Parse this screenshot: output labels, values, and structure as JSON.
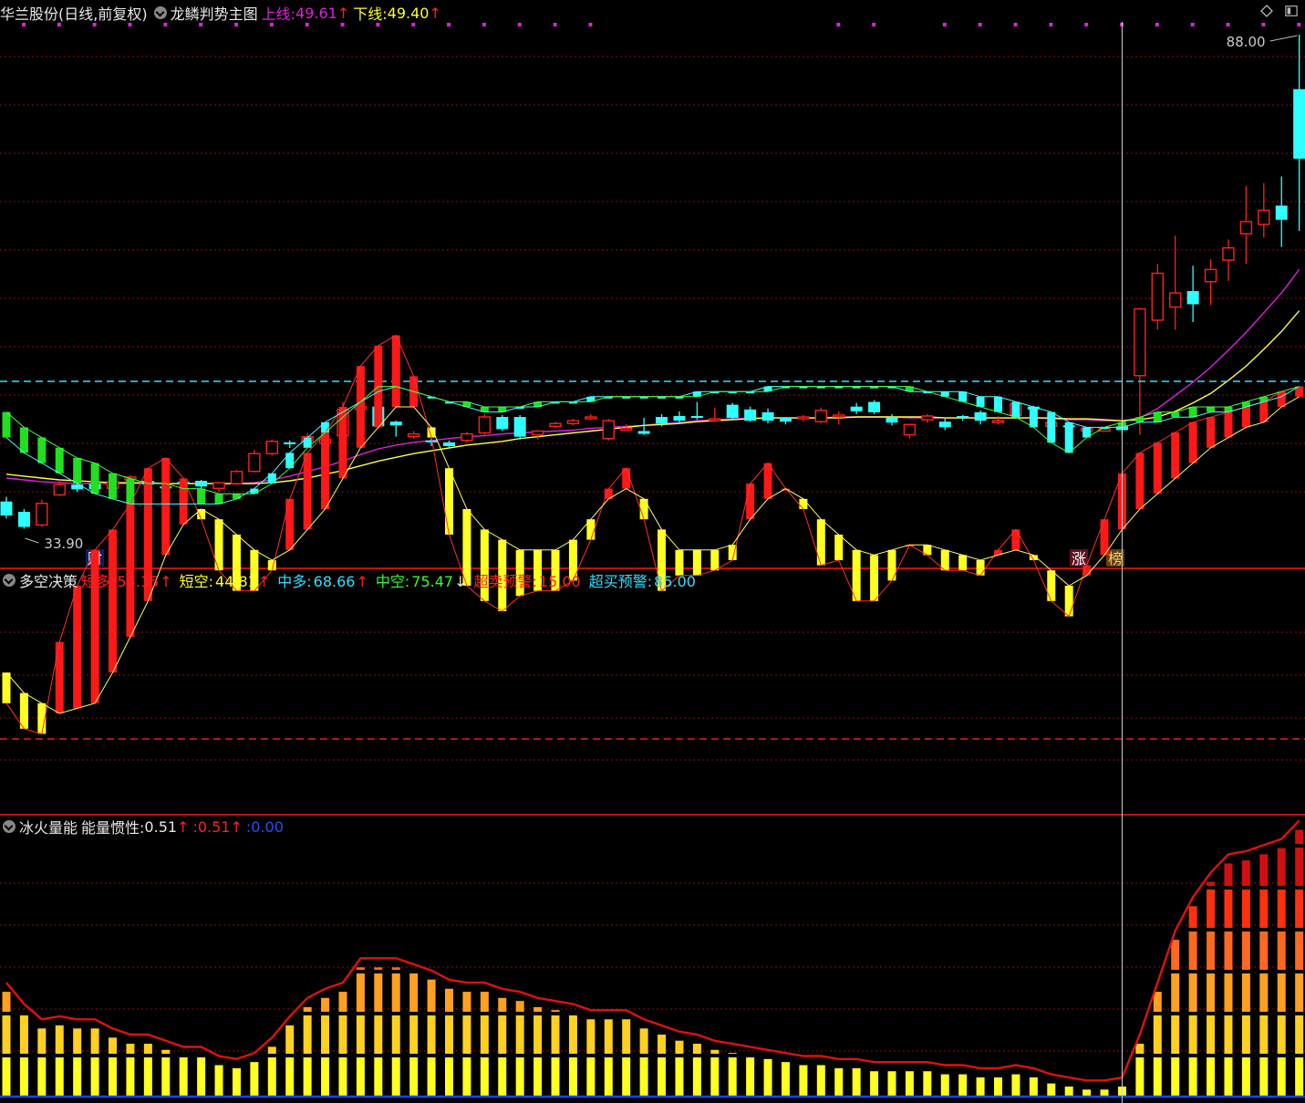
{
  "main_panel": {
    "stock_name": "华兰股份",
    "period": "(日线,前复权)",
    "indicator": "龙鳞判势主图",
    "upper_label": "上线:",
    "upper_value": "49.61",
    "upper_arrow": "↑",
    "lower_label": "下线:",
    "lower_value": "49.40",
    "lower_arrow": "↑",
    "high_marker": "88.00",
    "low_marker": "33.90",
    "badge_cai": "财",
    "badge_zhang": "涨",
    "badge_bang": "榜"
  },
  "panel2": {
    "name": "多空决策",
    "items": [
      {
        "label": "短多:",
        "value": "54.15",
        "arrow": "↑",
        "color": "#ff2020"
      },
      {
        "label": "短空:",
        "value": "44.81",
        "arrow": "↑",
        "color": "#ffff30"
      },
      {
        "label": "中多:",
        "value": "68.66",
        "arrow": "↑",
        "color": "#30e0ff"
      },
      {
        "label": "中空:",
        "value": "75.47",
        "arrow": "↓",
        "color": "#30ff30"
      },
      {
        "label": "超卖预警:",
        "value": "15.00",
        "arrow": "",
        "color": "#ff2020"
      },
      {
        "label": "超买预警:",
        "value": "85.00",
        "arrow": "",
        "color": "#30e0ff"
      }
    ]
  },
  "panel3": {
    "name": "冰火量能",
    "label1": "能量惯性:",
    "value1": "0.51",
    "arrow1": "↑",
    "label2": ":",
    "value2": "0.51",
    "arrow2": "↑",
    "label3": ":",
    "value3": "0.00"
  },
  "colors": {
    "up": "#ff2020",
    "down": "#30ffff",
    "ma1": "#e020e0",
    "ma2": "#ffff40",
    "grid": "#8a1010",
    "separator": "#c01010"
  },
  "chart_data": [
    {
      "type": "candlestick",
      "title": "龙鳞判势主图",
      "ylim": [
        33.9,
        88.0
      ],
      "open": [
        38.3,
        37.2,
        35.8,
        39.0,
        40.1,
        40.2,
        39.7,
        40.6,
        40.5,
        39.9,
        40.4,
        40.5,
        39.7,
        40.2,
        41.5,
        43.4,
        44.6,
        44.7,
        44.5,
        45.3,
        48.1,
        48.4,
        46.8,
        45.2,
        44.8,
        44.6,
        44.8,
        45.6,
        47.3,
        47.3,
        45.4,
        46.3,
        46.6,
        47.2,
        45.0,
        46.0,
        45.8,
        47.3,
        47.4,
        47.4,
        47.1,
        48.6,
        48.1,
        47.8,
        47.2,
        47.2,
        46.8,
        47.4,
        48.4,
        48.9,
        47.3,
        45.4,
        47.0,
        46.8,
        47.4,
        47.8,
        46.9,
        47.5,
        48.4,
        46.3,
        46.4,
        45.8,
        45.8,
        46.3,
        51.7,
        57.6,
        59.0,
        60.7,
        61.7,
        64.0,
        66.8,
        67.8,
        69.8,
        82.2
      ],
      "close": [
        36.8,
        35.6,
        38.1,
        40.1,
        39.6,
        39.6,
        40.4,
        40.9,
        40.1,
        39.7,
        40.2,
        39.9,
        40.3,
        41.5,
        43.4,
        44.7,
        44.4,
        45.2,
        44.9,
        48.1,
        48.4,
        46.3,
        46.4,
        45.5,
        44.6,
        44.2,
        45.5,
        47.3,
        46.0,
        45.2,
        45.8,
        46.6,
        46.9,
        47.3,
        46.9,
        46.1,
        45.5,
        46.6,
        46.9,
        47.3,
        47.1,
        47.2,
        46.9,
        46.9,
        46.8,
        47.3,
        48.0,
        47.5,
        47.9,
        47.8,
        46.7,
        46.5,
        47.4,
        46.2,
        47.2,
        46.9,
        46.9,
        48.7,
        48.1,
        46.7,
        46.3,
        46.1,
        46.1,
        45.9,
        58.8,
        62.6,
        60.5,
        59.3,
        63.0,
        65.3,
        68.1,
        69.3,
        68.3,
        74.8
      ],
      "high": [
        38.8,
        37.5,
        38.5,
        40.6,
        40.4,
        40.4,
        40.7,
        41.1,
        41.0,
        40.3,
        40.5,
        40.6,
        40.4,
        41.7,
        43.8,
        44.9,
        44.8,
        45.6,
        45.6,
        48.9,
        48.7,
        48.4,
        46.9,
        45.8,
        45.0,
        44.8,
        45.7,
        47.6,
        47.5,
        47.5,
        45.9,
        46.8,
        47.1,
        47.6,
        47.1,
        46.5,
        47.2,
        47.6,
        47.9,
        48.9,
        48.3,
        48.8,
        48.4,
        48.2,
        47.3,
        47.5,
        48.3,
        47.9,
        48.8,
        49.1,
        47.6,
        46.5,
        47.6,
        47.2,
        47.5,
        48.0,
        47.4,
        48.9,
        48.5,
        46.8,
        46.5,
        46.2,
        46.2,
        46.4,
        58.9,
        63.6,
        66.6,
        63.4,
        64.1,
        66.2,
        71.9,
        72.2,
        72.9,
        88.0
      ],
      "low": [
        36.5,
        35.4,
        35.6,
        38.9,
        39.3,
        39.5,
        39.6,
        40.4,
        40.0,
        39.4,
        39.9,
        39.5,
        39.3,
        40.1,
        41.4,
        43.2,
        44.0,
        44.5,
        44.0,
        45.1,
        47.7,
        46.1,
        45.2,
        45.0,
        44.2,
        44.0,
        44.6,
        45.4,
        45.8,
        44.9,
        44.9,
        46.1,
        46.4,
        47.0,
        44.8,
        45.8,
        45.4,
        46.3,
        46.6,
        47.0,
        46.9,
        47.0,
        46.8,
        46.6,
        46.5,
        46.8,
        46.6,
        46.5,
        47.6,
        47.6,
        46.4,
        45.0,
        46.7,
        45.9,
        46.9,
        46.5,
        46.5,
        47.3,
        48.0,
        46.2,
        45.9,
        45.9,
        45.7,
        45.4,
        45.4,
        56.6,
        56.6,
        57.4,
        59.2,
        61.8,
        63.6,
        66.4,
        65.4,
        67.1
      ],
      "series": [
        {
          "name": "上线",
          "values": [
            40.8,
            40.6,
            40.4,
            40.3,
            40.2,
            40.2,
            40.2,
            40.2,
            40.2,
            40.2,
            40.2,
            40.2,
            40.2,
            40.2,
            40.3,
            40.6,
            41.0,
            41.5,
            42.0,
            42.6,
            43.3,
            43.9,
            44.3,
            44.6,
            44.8,
            45.0,
            45.2,
            45.3,
            45.5,
            45.6,
            45.7,
            45.8,
            45.9,
            46.1,
            46.2,
            46.3,
            46.4,
            46.6,
            46.7,
            46.9,
            47.0,
            47.1,
            47.2,
            47.2,
            47.2,
            47.2,
            47.2,
            47.3,
            47.3,
            47.3,
            47.3,
            47.2,
            47.2,
            47.2,
            47.2,
            47.2,
            47.2,
            47.2,
            47.2,
            47.1,
            47.0,
            47.0,
            46.9,
            46.9,
            47.2,
            48.2,
            49.6,
            51.0,
            52.6,
            54.4,
            56.3,
            58.4,
            60.5,
            63.0
          ]
        },
        {
          "name": "下线",
          "values": [
            41.2,
            41.0,
            40.8,
            40.6,
            40.5,
            40.4,
            40.3,
            40.3,
            40.3,
            40.2,
            40.2,
            40.2,
            40.2,
            40.2,
            40.2,
            40.3,
            40.5,
            40.8,
            41.2,
            41.6,
            42.1,
            42.6,
            43.0,
            43.4,
            43.7,
            44.0,
            44.3,
            44.5,
            44.7,
            45.0,
            45.2,
            45.4,
            45.6,
            45.8,
            46.0,
            46.2,
            46.4,
            46.5,
            46.6,
            46.8,
            46.9,
            47.0,
            47.1,
            47.2,
            47.2,
            47.2,
            47.2,
            47.2,
            47.3,
            47.3,
            47.3,
            47.3,
            47.3,
            47.2,
            47.2,
            47.2,
            47.2,
            47.2,
            47.2,
            47.2,
            47.1,
            47.1,
            47.0,
            46.9,
            47.0,
            47.3,
            47.9,
            48.8,
            49.8,
            51.2,
            52.7,
            54.5,
            56.4,
            58.6
          ]
        }
      ]
    },
    {
      "type": "bar",
      "title": "多空决策",
      "ylim": [
        0,
        100
      ],
      "overbought": 85.0,
      "oversold": 15.0,
      "series": [
        {
          "name": "短多",
          "values": [
            22,
            17,
            16,
            34,
            45,
            52,
            56,
            61,
            68,
            70,
            66,
            58,
            48,
            44,
            44,
            48,
            62,
            71,
            75,
            80,
            88,
            92,
            94,
            86,
            74,
            55,
            45,
            42,
            40,
            43,
            44,
            44,
            46,
            54,
            64,
            68,
            58,
            44,
            47,
            47,
            48,
            50,
            65,
            69,
            64,
            60,
            49,
            50,
            42,
            42,
            46,
            53,
            51,
            48,
            48,
            47,
            52,
            56,
            50,
            42,
            39,
            49,
            58,
            67,
            71,
            73,
            75,
            77,
            78,
            79,
            80,
            81,
            83,
            84
          ]
        },
        {
          "name": "短空",
          "values": [
            28,
            24,
            22,
            20,
            21,
            22,
            28,
            35,
            42,
            51,
            57,
            60,
            58,
            55,
            52,
            50,
            52,
            56,
            60,
            66,
            72,
            76,
            80,
            80,
            76,
            68,
            60,
            56,
            54,
            52,
            52,
            52,
            54,
            58,
            62,
            64,
            62,
            56,
            52,
            52,
            52,
            53,
            58,
            62,
            64,
            62,
            58,
            55,
            52,
            51,
            52,
            53,
            53,
            52,
            51,
            50,
            51,
            52,
            51,
            48,
            45,
            47,
            51,
            56,
            60,
            63,
            66,
            69,
            72,
            74,
            76,
            77,
            80,
            82
          ]
        },
        {
          "name": "中多",
          "values": [
            74,
            71,
            69,
            67,
            65,
            63,
            62,
            61,
            61,
            61,
            61,
            61,
            61,
            62,
            64,
            67,
            71,
            74,
            77,
            79,
            81,
            83,
            84,
            83,
            82,
            81,
            80,
            79,
            79,
            80,
            80,
            81,
            81,
            82,
            82,
            82,
            82,
            82,
            82,
            83,
            83,
            83,
            83,
            84,
            84,
            84,
            84,
            84,
            84,
            84,
            84,
            83,
            83,
            83,
            83,
            82,
            82,
            81,
            80,
            79,
            77,
            76,
            76,
            76,
            77,
            77,
            78,
            78,
            79,
            79,
            80,
            81,
            82,
            84
          ]
        },
        {
          "name": "中空",
          "values": [
            79,
            76,
            74,
            72,
            70,
            69,
            67,
            66,
            65,
            65,
            64,
            64,
            63,
            63,
            63,
            65,
            68,
            72,
            75,
            78,
            81,
            84,
            84,
            83,
            82,
            81,
            81,
            80,
            80,
            80,
            81,
            81,
            81,
            81,
            82,
            82,
            82,
            82,
            82,
            82,
            83,
            83,
            83,
            83,
            84,
            84,
            84,
            84,
            84,
            84,
            84,
            84,
            83,
            82,
            81,
            80,
            79,
            78,
            76,
            73,
            71,
            74,
            76,
            77,
            78,
            79,
            79,
            80,
            80,
            80,
            81,
            82,
            83,
            84
          ]
        }
      ]
    },
    {
      "type": "bar",
      "title": "冰火量能",
      "series": [
        {
          "name": "能量惯性",
          "values": [
            0.34,
            0.27,
            0.22,
            0.23,
            0.22,
            0.22,
            0.19,
            0.17,
            0.17,
            0.15,
            0.13,
            0.13,
            0.1,
            0.09,
            0.11,
            0.16,
            0.23,
            0.29,
            0.32,
            0.34,
            0.42,
            0.42,
            0.42,
            0.4,
            0.38,
            0.35,
            0.34,
            0.34,
            0.32,
            0.31,
            0.29,
            0.28,
            0.27,
            0.25,
            0.25,
            0.25,
            0.22,
            0.2,
            0.18,
            0.17,
            0.15,
            0.14,
            0.13,
            0.12,
            0.11,
            0.1,
            0.1,
            0.09,
            0.09,
            0.08,
            0.08,
            0.08,
            0.08,
            0.07,
            0.07,
            0.06,
            0.06,
            0.07,
            0.06,
            0.04,
            0.03,
            0.02,
            0.02,
            0.03,
            0.17,
            0.34,
            0.51,
            0.62,
            0.7,
            0.76,
            0.77,
            0.79,
            0.81,
            0.87
          ]
        }
      ]
    }
  ]
}
